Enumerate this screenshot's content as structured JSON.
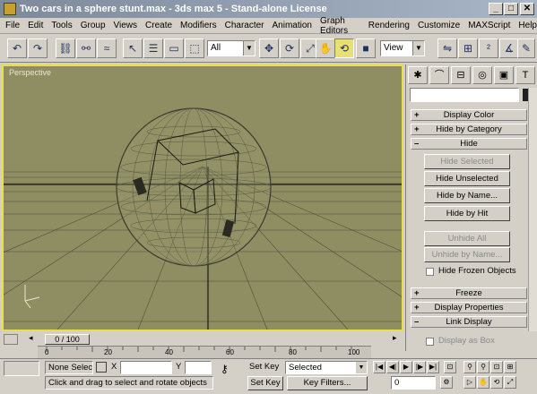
{
  "window": {
    "title": "Two cars in a sphere stunt.max - 3ds max 5 - Stand-alone License",
    "minimize": "_",
    "maximize": "□",
    "close": "✕"
  },
  "menu": [
    "File",
    "Edit",
    "Tools",
    "Group",
    "Views",
    "Create",
    "Modifiers",
    "Character",
    "Animation",
    "Graph Editors",
    "Rendering",
    "Customize",
    "MAXScript",
    "Help"
  ],
  "toolbar": {
    "selection_filter": "All",
    "reference_coord": "View"
  },
  "viewport": {
    "label": "Perspective"
  },
  "command_panel": {
    "rollouts": {
      "display_color": "Display Color",
      "hide_by_category": "Hide by Category",
      "hide": "Hide",
      "freeze": "Freeze",
      "display_properties": "Display Properties",
      "link_display": "Link Display"
    },
    "hide_buttons": {
      "hide_selected": "Hide Selected",
      "hide_unselected": "Hide Unselected",
      "hide_by_name": "Hide by Name...",
      "hide_by_hit": "Hide by Hit",
      "unhide_all": "Unhide All",
      "unhide_by_name": "Unhide by Name..."
    },
    "hide_frozen_objects": "Hide Frozen Objects",
    "display_as_box": "Display as Box",
    "signs": {
      "plus": "+",
      "minus": "–"
    }
  },
  "timeline": {
    "slider_label": "0 / 100",
    "ticks": [
      "0",
      "20",
      "40",
      "60",
      "80",
      "100"
    ]
  },
  "status": {
    "selection": "None Selected",
    "prompt": "Click and drag to select and rotate objects",
    "x_label": "X",
    "y_label": "Y",
    "z_label": "Z",
    "set_key_label": "Set Key",
    "key_filter": "Selected",
    "auto_key": "Set Key",
    "key_filters_button": "Key Filters...",
    "frame": "0"
  }
}
